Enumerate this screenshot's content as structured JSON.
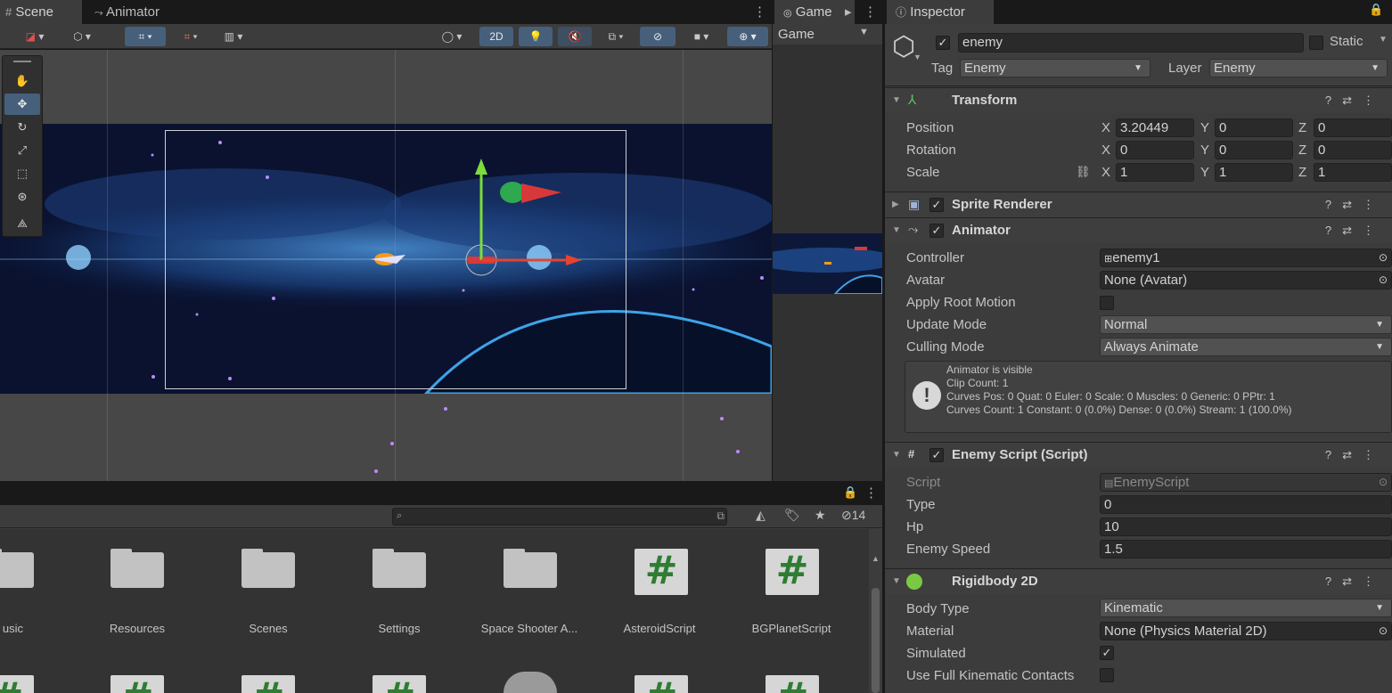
{
  "tabs": {
    "scene": "Scene",
    "animator": "Animator",
    "game": "Game",
    "inspector": "Inspector"
  },
  "scene_toolbar": {
    "mode_2d": "2D"
  },
  "game": {
    "display": "Game"
  },
  "project": {
    "hidden_count": "14",
    "items": [
      {
        "label": "usic",
        "kind": "folder"
      },
      {
        "label": "Resources",
        "kind": "folder"
      },
      {
        "label": "Scenes",
        "kind": "folder"
      },
      {
        "label": "Settings",
        "kind": "folder"
      },
      {
        "label": "Space Shooter A...",
        "kind": "folder"
      },
      {
        "label": "AsteroidScript",
        "kind": "script"
      },
      {
        "label": "BGPlanetScript",
        "kind": "script"
      }
    ],
    "script_glyph": "#"
  },
  "inspector": {
    "object_name": "enemy",
    "static_label": "Static",
    "tag_label": "Tag",
    "tag_value": "Enemy",
    "layer_label": "Layer",
    "layer_value": "Enemy",
    "transform": {
      "title": "Transform",
      "position_label": "Position",
      "rotation_label": "Rotation",
      "scale_label": "Scale",
      "axes": [
        "X",
        "Y",
        "Z"
      ],
      "position": [
        "3.20449",
        "0",
        "0"
      ],
      "rotation": [
        "0",
        "0",
        "0"
      ],
      "scale": [
        "1",
        "1",
        "1"
      ]
    },
    "sprite_renderer": {
      "title": "Sprite Renderer"
    },
    "animator": {
      "title": "Animator",
      "controller_label": "Controller",
      "controller_value": "enemy1",
      "avatar_label": "Avatar",
      "avatar_value": "None (Avatar)",
      "apply_root_motion_label": "Apply Root Motion",
      "update_mode_label": "Update Mode",
      "update_mode_value": "Normal",
      "culling_mode_label": "Culling Mode",
      "culling_mode_value": "Always Animate",
      "info_lines": [
        "Animator is visible",
        "Clip Count: 1",
        "Curves Pos: 0 Quat: 0 Euler: 0 Scale: 0 Muscles: 0 Generic: 0 PPtr: 1",
        "Curves Count: 1 Constant: 0 (0.0%) Dense: 0 (0.0%) Stream: 1 (100.0%)"
      ]
    },
    "enemy_script": {
      "title": "Enemy Script (Script)",
      "script_label": "Script",
      "script_value": "EnemyScript",
      "type_label": "Type",
      "type_value": "0",
      "hp_label": "Hp",
      "hp_value": "10",
      "speed_label": "Enemy Speed",
      "speed_value": "1.5"
    },
    "rigidbody": {
      "title": "Rigidbody 2D",
      "body_type_label": "Body Type",
      "body_type_value": "Kinematic",
      "material_label": "Material",
      "material_value": "None (Physics Material 2D)",
      "simulated_label": "Simulated",
      "kinematic_contacts_label": "Use Full Kinematic Contacts"
    }
  }
}
